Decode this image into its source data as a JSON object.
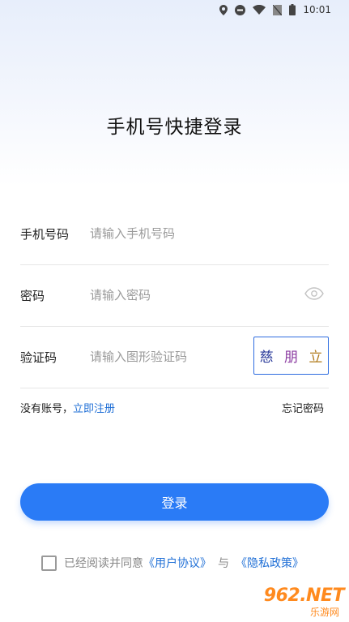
{
  "status_bar": {
    "time": "10:01",
    "icons": [
      "location-icon",
      "do-not-disturb-icon",
      "wifi-icon",
      "no-sim-icon",
      "battery-icon"
    ]
  },
  "title": "手机号快捷登录",
  "form": {
    "phone": {
      "label": "手机号码",
      "placeholder": "请输入手机号码",
      "value": ""
    },
    "password": {
      "label": "密码",
      "placeholder": "请输入密码",
      "value": "",
      "toggle_icon": "eye-icon"
    },
    "captcha": {
      "label": "验证码",
      "placeholder": "请输入图形验证码",
      "value": "",
      "chars": [
        "慈",
        "朋",
        "立"
      ]
    }
  },
  "links": {
    "no_account": "没有账号，",
    "register": "立即注册",
    "forgot": "忘记密码"
  },
  "login_button": "登录",
  "agreement": {
    "checked": false,
    "prefix": "已经阅读并同意",
    "user_agreement": "《用户协议》",
    "and": "与",
    "privacy": "《隐私政策》"
  },
  "watermark": {
    "logo": "962.NET",
    "site": "乐游网"
  },
  "colors": {
    "accent": "#2a7bf6",
    "link": "#1f6fd6",
    "captcha_border": "#2f6de0"
  }
}
